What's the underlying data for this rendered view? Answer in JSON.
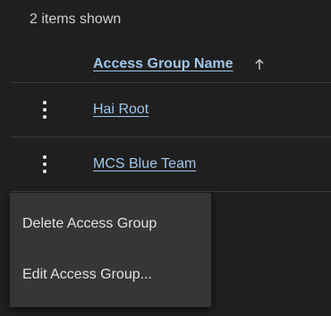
{
  "summary": {
    "count_text": "2 items shown"
  },
  "table": {
    "column_header": "Access Group Name",
    "sort_icon": "arrow-up-icon",
    "rows": [
      {
        "name": "Hai Root"
      },
      {
        "name": "MCS Blue Team"
      }
    ]
  },
  "context_menu": {
    "items": [
      {
        "label": "Delete Access Group"
      },
      {
        "label": "Edit Access Group..."
      }
    ]
  },
  "colors": {
    "background": "#1f1f1f",
    "link": "#9fc6ea",
    "menu_background": "#363636",
    "divider": "#3a3a3a"
  }
}
